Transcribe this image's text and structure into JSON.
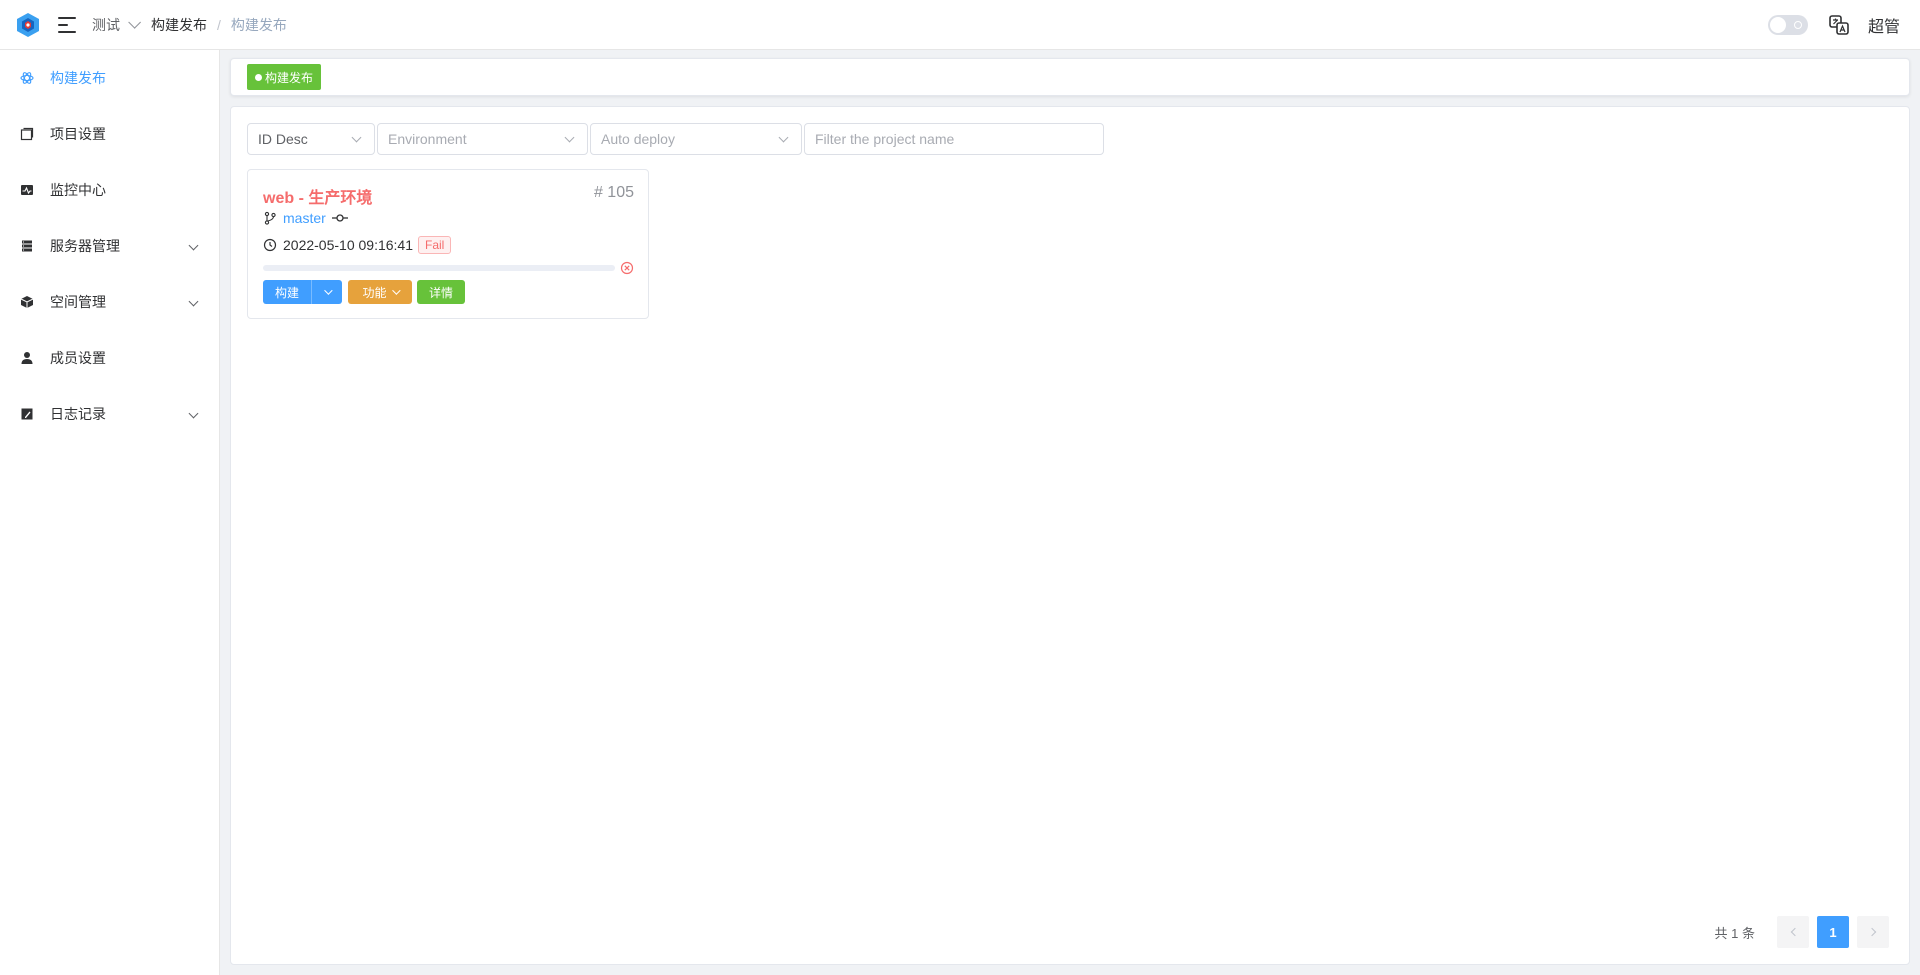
{
  "header": {
    "workspace": "测试",
    "breadcrumb": [
      "构建发布",
      "构建发布"
    ],
    "user": "超管"
  },
  "sidebar": {
    "items": [
      {
        "label": "构建发布",
        "icon": "build-icon",
        "active": true,
        "expandable": false
      },
      {
        "label": "项目设置",
        "icon": "project-icon",
        "active": false,
        "expandable": false
      },
      {
        "label": "监控中心",
        "icon": "monitor-icon",
        "active": false,
        "expandable": false
      },
      {
        "label": "服务器管理",
        "icon": "server-icon",
        "active": false,
        "expandable": true
      },
      {
        "label": "空间管理",
        "icon": "cube-icon",
        "active": false,
        "expandable": true
      },
      {
        "label": "成员设置",
        "icon": "user-icon",
        "active": false,
        "expandable": false
      },
      {
        "label": "日志记录",
        "icon": "log-icon",
        "active": false,
        "expandable": true
      }
    ]
  },
  "tags": [
    {
      "label": "构建发布",
      "color": "#67c23a"
    }
  ],
  "filters": {
    "sort": "ID Desc",
    "environment_placeholder": "Environment",
    "autodeploy_placeholder": "Auto deploy",
    "search_placeholder": "Filter the project name"
  },
  "card": {
    "title": "web - 生产环境",
    "id": "# 105",
    "branch": "master",
    "time": "2022-05-10 09:16:41",
    "status": "Fail",
    "progress": 0,
    "btn_build": "构建",
    "btn_func": "功能",
    "btn_detail": "详情"
  },
  "pagination": {
    "total": "共 1 条",
    "page": "1"
  },
  "colors": {
    "primary": "#409eff",
    "success": "#67c23a",
    "warning": "#e6a23c",
    "danger": "#f56c6c"
  }
}
